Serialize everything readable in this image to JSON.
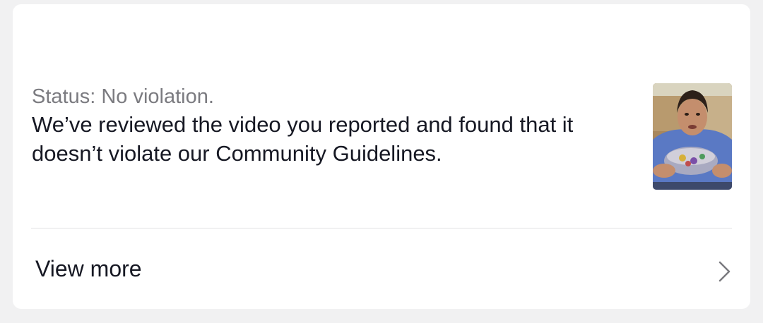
{
  "report": {
    "status": "Status: No violation.",
    "message": "We’ve reviewed the video you reported and found that it doesn’t violate our Community Guidelines."
  },
  "thumbnail": {
    "icon": "video-thumbnail"
  },
  "footer": {
    "view_more_label": "View more",
    "chevron_icon": "chevron-right-icon"
  },
  "colors": {
    "background": "#f1f1f2",
    "card": "#ffffff",
    "primary_text": "#161823",
    "secondary_text": "#7b7b80",
    "divider": "#e3e3e4"
  }
}
